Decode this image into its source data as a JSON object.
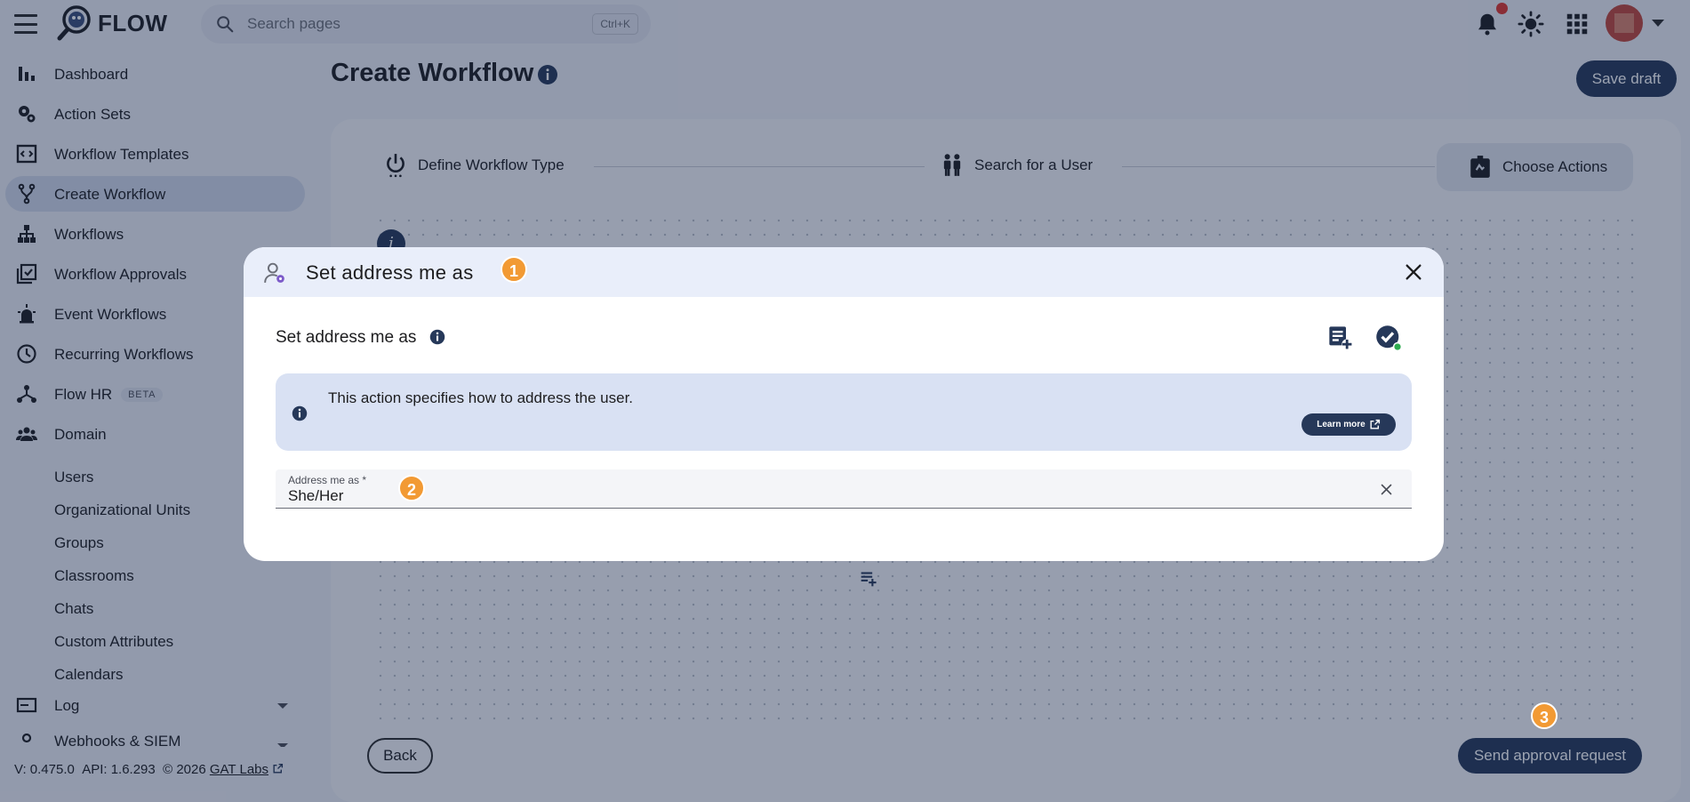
{
  "app": {
    "name": "FLOW"
  },
  "search": {
    "placeholder": "Search pages",
    "shortcut": "Ctrl+K"
  },
  "sidebar": {
    "items": [
      {
        "label": "Dashboard",
        "icon": "bar-chart-icon"
      },
      {
        "label": "Action Sets",
        "icon": "gears-icon"
      },
      {
        "label": "Workflow Templates",
        "icon": "template-icon"
      },
      {
        "label": "Create Workflow",
        "icon": "fork-icon",
        "active": true
      },
      {
        "label": "Workflows",
        "icon": "hierarchy-icon"
      },
      {
        "label": "Workflow Approvals",
        "icon": "approval-icon"
      },
      {
        "label": "Event Workflows",
        "icon": "siren-icon"
      },
      {
        "label": "Recurring Workflows",
        "icon": "clock-icon"
      },
      {
        "label": "Flow HR",
        "icon": "org-icon",
        "badge": "BETA"
      },
      {
        "label": "Domain",
        "icon": "people-icon"
      }
    ],
    "domain_sub": [
      "Users",
      "Organizational Units",
      "Groups",
      "Classrooms",
      "Chats",
      "Custom Attributes",
      "Calendars"
    ],
    "log_label": "Log",
    "webhooks_label": "Webhooks & SIEM"
  },
  "footer": {
    "version": "V: 0.475.0",
    "api": "API: 1.6.293",
    "copyright": "© 2026",
    "company": "GAT Labs"
  },
  "page": {
    "title": "Create Workflow",
    "save_draft": "Save draft"
  },
  "stepper": {
    "steps": [
      {
        "label": "Define Workflow Type",
        "icon": "power-icon"
      },
      {
        "label": "Search for a User",
        "icon": "people-icon"
      },
      {
        "label": "Choose Actions",
        "icon": "actions-icon",
        "current": true
      }
    ]
  },
  "buttons": {
    "back": "Back",
    "send": "Send approval request"
  },
  "modal": {
    "title": "Set address me as",
    "section_title": "Set address me as",
    "info_text": "This action specifies how to address the user.",
    "learn_more": "Learn more",
    "field_label": "Address me as *",
    "field_value": "She/Her"
  },
  "badges": {
    "one": "1",
    "two": "2",
    "three": "3"
  },
  "colors": {
    "primary": "#263859",
    "accent_badge": "#f29a34",
    "notification": "#e0352b",
    "active_nav": "#d3d9ea",
    "info_banner": "#d9e1f3"
  }
}
